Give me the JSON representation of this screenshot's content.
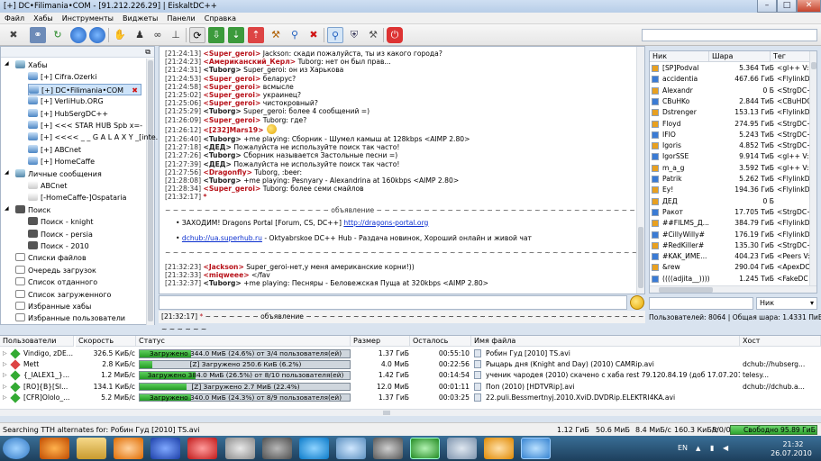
{
  "window": {
    "title": "[+] DC•Filimania•COM - [91.212.226.29] | EiskaltDC++"
  },
  "menu": [
    "Файл",
    "Хабы",
    "Инструменты",
    "Виджеты",
    "Панели",
    "Справка"
  ],
  "tree": {
    "hubs_label": "Хабы",
    "hubs": [
      "[+] Cifra.Ozerki",
      "[+] DC•Filimania•COM",
      "[+] VerliHub.ORG",
      "[+] HubSergDC++",
      "[+] <<< STAR HUB Spb x=-",
      "[+] <<<< _ _ G A L A X Y _[inte...",
      "[+] ABCnet",
      "[+] HomeCaffe"
    ],
    "pm_label": "Личные сообщения",
    "pms": [
      "ABCnet",
      "[-HomeCaffe-]Ospataria"
    ],
    "search_label": "Поиск",
    "searches": [
      "Поиск - knight",
      "Поиск - persia",
      "Поиск - 2010"
    ],
    "others": [
      "Списки файлов",
      "Очередь загрузок",
      "Список отданного",
      "Список загруженного",
      "Избранные хабы",
      "Избранные пользователи"
    ]
  },
  "chat": [
    {
      "ts": "[21:24:13]",
      "nick": "<Super_geroi>",
      "msg": " Jackson: скади пожалуйста, ты из какого города?"
    },
    {
      "ts": "[21:24:23]",
      "nick": "<Американский_Керл>",
      "msg": " Tuborg: нет он был прав..."
    },
    {
      "ts": "[21:24:31]",
      "nick": "<Tuborg>",
      "msg": " Super_geroi: он из Харькова"
    },
    {
      "ts": "[21:24:53]",
      "nick": "<Super_geroi>",
      "msg": " беларус?"
    },
    {
      "ts": "[21:24:58]",
      "nick": "<Super_geroi>",
      "msg": " всмысле"
    },
    {
      "ts": "[21:25:02]",
      "nick": "<Super_geroi>",
      "msg": " украинец?"
    },
    {
      "ts": "[21:25:06]",
      "nick": "<Super_geroi>",
      "msg": " чистокровный?"
    },
    {
      "ts": "[21:25:29]",
      "nick": "<Tuborg>",
      "msg": " Super_geroi: более 4 сообщений =)"
    },
    {
      "ts": "[21:26:09]",
      "nick": "<Super_geroi>",
      "msg": " Tuborg: где?"
    },
    {
      "ts": "[21:26:12]",
      "nick": "<[232]Mars19>",
      "msg": ""
    },
    {
      "ts": "[21:26:40]",
      "nick": "<Tuborg>",
      "msg": " +me playing: Сборник - Шумел камыш  at 128kbps <AIMP 2.80>"
    },
    {
      "ts": "[21:27:18]",
      "nick": "<ДЕД>",
      "msg": " Пожалуйста не используйте поиск так часто!"
    },
    {
      "ts": "[21:27:26]",
      "nick": "<Tuborg>",
      "msg": " Сборник называется     Застольные песни    =)"
    },
    {
      "ts": "[21:27:39]",
      "nick": "<ДЕД>",
      "msg": " Пожалуйста не используйте поиск так часто!"
    },
    {
      "ts": "[21:27:56]",
      "nick": "<Dragonfly>",
      "msg": " Tuborg, :beer:"
    },
    {
      "ts": "[21:28:08]",
      "nick": "<Tuborg>",
      "msg": " +me playing: Pesnyary - Alexandrina  at 160kbps <AIMP 2.80>"
    },
    {
      "ts": "[21:28:34]",
      "nick": "<Super_geroi>",
      "msg": " Tuborg: более семи смайлов"
    },
    {
      "ts": "[21:32:17]",
      "nick": "*",
      "msg": ""
    }
  ],
  "announce": {
    "header": "~ ~ ~ ~ ~ ~ ~ ~ ~ ~ ~ ~ ~ ~ ~ ~ ~ ~ ~ ~ ~ объявление ~ ~ ~ ~ ~ ~ ~ ~ ~ ~ ~ ~ ~ ~ ~ ~ ~ ~ ~ ~ ~ ~ ~ ~ ~ ~ ~ ~ ~ ~ ~ ~ ~ ~ ~ ~ ~ ~ ~ ~ ~ ~ ~ ~",
    "line1_text": "ЗАХОДИМ! Dragons Portal [Forum, CS, DC++] ",
    "line1_link": "http://dragons-portal.org",
    "line2_link": "dchub://ua.superhub.ru",
    "line2_text": " - Oktyabrskoe DC++ Hub - Раздача новинок, Хороший онлайн и живой чат",
    "footer": "~ ~ ~ ~ ~ ~ ~ ~ ~ ~ ~ ~ ~ ~ ~ ~ ~ ~ ~ ~ ~ ~ ~ ~ ~ ~ ~ ~ ~ ~ ~ ~ ~ ~ ~ ~ ~ ~ ~ ~ ~ ~ ~ ~ ~ ~ ~ ~ ~ ~ ~ ~ ~ ~ ~ ~ ~ ~ ~ ~ ~ ~ ~ ~ ~ ~ ~ ~ объявление ~ ~ ~ ~ ~ ~ ~ ~ ~ ~ ~ ~"
  },
  "chat_after": [
    {
      "ts": "[21:32:23]",
      "nick": "<Jackson>",
      "msg": " Super_geroi-нет,у меня американские корни!))"
    },
    {
      "ts": "[21:32:33]",
      "nick": "<miqweee>",
      "msg": " </fav"
    },
    {
      "ts": "[21:32:37]",
      "nick": "<Tuborg>",
      "msg": " +me playing: Песняры - Беловежская Пуща  at 320kbps <AIMP 2.80>"
    }
  ],
  "status_line": {
    "ts": "[21:32:17]",
    "star": "*",
    "text": " ~ ~ ~ ~ ~ ~ ~ объявление ~ ~ ~ ~ ~ ~ ~ ~ ~ ~ ~ ~ ~ ~ ~ ~ ~ ~ ~ ~ ~ ~ ~ ~ ~ ~ ~ ~ ~ ~ ~ ~ ~ ~ ~ ~ ~ ~ ~ ~ ~ ~ ~ ~ ~ ~ ~ ~ ~"
  },
  "users_header": {
    "nick": "Ник",
    "share": "Шара",
    "tag": "Тег"
  },
  "users": [
    {
      "nick": "[SP]Podval",
      "share": "5.364 ТиБ",
      "tag": "<gl++ V:0."
    },
    {
      "nick": "accidentia",
      "share": "467.66 ГиБ",
      "tag": "<FlylinkDC+"
    },
    {
      "nick": "Alexandr",
      "share": "0 Б",
      "tag": "<StrgDC++"
    },
    {
      "nick": "CBuHKo",
      "share": "2.844 ТиБ",
      "tag": "<CBuHDC V"
    },
    {
      "nick": "Dstrenger",
      "share": "153.13 ГиБ",
      "tag": "<FlylinkDC+"
    },
    {
      "nick": "Floyd",
      "share": "274.95 ГиБ",
      "tag": "<StrgDC++"
    },
    {
      "nick": "IFIO",
      "share": "5.243 ТиБ",
      "tag": "<StrgDC++"
    },
    {
      "nick": "Igoris",
      "share": "4.852 ТиБ",
      "tag": "<StrgDC++"
    },
    {
      "nick": "IgorSSE",
      "share": "9.914 ТиБ",
      "tag": "<gl++ V:0."
    },
    {
      "nick": "m_a_g",
      "share": "3.592 ТиБ",
      "tag": "<gl++ V:5."
    },
    {
      "nick": "Patrik",
      "share": "5.262 ТиБ",
      "tag": "<FlylinkDC+"
    },
    {
      "nick": "Ey!",
      "share": "194.36 ГиБ",
      "tag": "<FlylinkDC+"
    },
    {
      "nick": "ДЕД",
      "share": "0 Б",
      "tag": ""
    },
    {
      "nick": "Ракот",
      "share": "17.705 ТиБ",
      "tag": "<StrgDC++"
    },
    {
      "nick": "##FILMS_Д...",
      "share": "384.79 ГиБ",
      "tag": "<FlylinkDC+"
    },
    {
      "nick": "#CillyWilly#",
      "share": "176.19 ГиБ",
      "tag": "<FlylinkDC+"
    },
    {
      "nick": "#RedKiller#",
      "share": "135.30 ГиБ",
      "tag": "<StrgDC++"
    },
    {
      "nick": "#KAK_ИМЕ...",
      "share": "404.23 ГиБ",
      "tag": "<Peers V:("
    },
    {
      "nick": "&rew",
      "share": "290.04 ГиБ",
      "tag": "<ApexDC+"
    },
    {
      "nick": "((((adjita__))))",
      "share": "1.245 ТиБ",
      "tag": "<FakeDC V:"
    }
  ],
  "user_filter": {
    "select": "Ник"
  },
  "user_count": "Пользователей: 8064 | Общая шара: 1.4331 ПиБ",
  "transfers_header": [
    "Пользователи",
    "Скорость",
    "Статус",
    "Размер",
    "Осталось",
    "Имя файла",
    "Хост"
  ],
  "transfers": [
    {
      "user": "Vindigo, zDE...",
      "speed": "326.5 КиБ/с",
      "status": "Загружено 344.0 МиБ (24.6%) от 3/4 пользователя(ей)",
      "progress": 24.6,
      "size": "1.37 ГиБ",
      "left": "00:55:10",
      "file": "Робин Гуд [2010] TS.avi",
      "host": ""
    },
    {
      "user": "Mett",
      "speed": "2.8 КиБ/с",
      "status": "[Z] Загружено 250.6 КиБ (6.2%)",
      "progress": 6.2,
      "size": "4.0 МиБ",
      "left": "00:22:56",
      "file": "Рыцарь дня (Knight and Day) (2010) CAMRip.avi",
      "host": "dchub://hubserg..."
    },
    {
      "user": "{_IALEX1_}...",
      "speed": "1.2 МиБ/с",
      "status": "Загружено 384.0 МиБ (26.5%) от 8/10 пользователя(ей)",
      "progress": 26.5,
      "size": "1.42 ГиБ",
      "left": "00:14:54",
      "file": "ученик чародея (2010) скачено с хаба rest 79.120.84.19 (доб 17.07.2010)",
      "host": "telesy..."
    },
    {
      "user": "[RO]{B}[SI...",
      "speed": "134.1 КиБ/с",
      "status": "[Z] Загружено 2.7 МиБ (22.4%)",
      "progress": 22.4,
      "size": "12.0 МиБ",
      "left": "00:01:11",
      "file": "Поп (2010) [HDTVRip].avi",
      "host": "dchub://dchub.a..."
    },
    {
      "user": "[CFR]Ololo_...",
      "speed": "5.2 МиБ/с",
      "status": "Загружено 340.0 МиБ (24.3%) от 8/9 пользователя(ей)",
      "progress": 24.3,
      "size": "1.37 ГиБ",
      "left": "00:03:25",
      "file": "22.puli.Bessmertnyj.2010.XviD.DVDRip.ELEKTRI4KA.avi",
      "host": ""
    }
  ],
  "statusbar": {
    "message": "Searching TTH alternates for: Робин Гуд [2010] TS.avi",
    "s1": "1.12 ГиБ",
    "s2": "50.6 МиБ",
    "s3": "8.4 МиБ/с",
    "s4": "160.3 КиБ/с",
    "s5": "8/0/0",
    "free": "Свободно 95.89 ГиБ"
  },
  "taskbar": {
    "lang": "EN",
    "time": "21:32",
    "date": "26.07.2010"
  },
  "colors": {
    "nick": "#b8121a",
    "link": "#0b2fcf",
    "progress": "#2ea32e"
  }
}
